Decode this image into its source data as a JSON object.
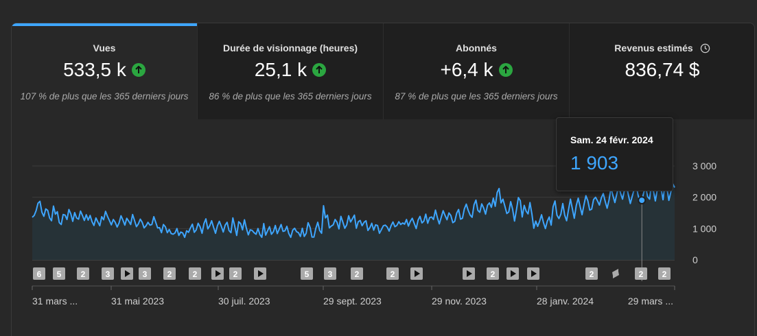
{
  "metrics": [
    {
      "label": "Vues",
      "value": "533,5 k",
      "trend": "up",
      "sub": "107 % de plus que les 365 derniers jours",
      "active": true
    },
    {
      "label": "Durée de visionnage (heures)",
      "value": "25,1 k",
      "trend": "up",
      "sub": "86 % de plus que les 365 derniers jours",
      "active": false
    },
    {
      "label": "Abonnés",
      "value": "+6,4 k",
      "trend": "up",
      "sub": "87 % de plus que les 365 derniers jours",
      "active": false
    },
    {
      "label": "Revenus estimés",
      "value": "836,74 $",
      "trend": "none",
      "sub": "",
      "active": false,
      "icon": "clock-icon"
    }
  ],
  "tooltip": {
    "date": "Sam. 24 févr. 2024",
    "value": "1 903"
  },
  "colors": {
    "line": "#3ea6ff",
    "accent": "#3ea6ff",
    "up": "#2ba640"
  },
  "chart_data": {
    "type": "line",
    "x_start": "2022-03-31",
    "x_end": "2024-03-29",
    "ylim": [
      0,
      3000
    ],
    "y_ticks": [
      "3 000",
      "2 000",
      "1 000",
      "0"
    ],
    "x_ticks": [
      "31 mars ...",
      "31 mai 2023",
      "30 juil. 2023",
      "29 sept. 2023",
      "29 nov. 2023",
      "28 janv. 2024",
      "29 mars ..."
    ],
    "highlight": {
      "date": "Sam. 24 févr. 2024",
      "value": 1903
    },
    "values": [
      1360,
      1420,
      1570,
      1810,
      1870,
      1520,
      1390,
      1630,
      1580,
      1340,
      1250,
      1720,
      1460,
      1540,
      1190,
      1130,
      1450,
      1430,
      1290,
      1610,
      1470,
      1230,
      1510,
      1340,
      1300,
      1560,
      1420,
      1260,
      1440,
      1270,
      1420,
      1220,
      1100,
      1340,
      1210,
      1090,
      1380,
      1280,
      1550,
      1390,
      1260,
      1120,
      1290,
      1200,
      1050,
      1180,
      1410,
      1270,
      1110,
      1330,
      1240,
      1130,
      1450,
      1260,
      1060,
      1150,
      1300,
      1200,
      1020,
      1090,
      1200,
      1110,
      1130,
      1380,
      1200,
      1020,
      1030,
      870,
      1130,
      1060,
      870,
      970,
      840,
      820,
      860,
      1000,
      780,
      890,
      860,
      720,
      930,
      880,
      1020,
      1140,
      880,
      960,
      1170,
      1060,
      850,
      1160,
      1310,
      990,
      1090,
      1250,
      1040,
      850,
      1090,
      1230,
      1070,
      890,
      1110,
      1200,
      940,
      870,
      1340,
      1070,
      780,
      1220,
      1160,
      960,
      1280,
      1010,
      800,
      960,
      940,
      870,
      820,
      1000,
      810,
      720,
      1160,
      790,
      930,
      1060,
      820,
      900,
      1100,
      840,
      980,
      1130,
      910,
      930,
      1070,
      840,
      720,
      950,
      1010,
      900,
      870,
      750,
      1010,
      750,
      850,
      1190,
      1040,
      730,
      730,
      1010,
      1200,
      940,
      850,
      1730,
      1340,
      1430,
      1020,
      1080,
      1120,
      1290,
      1200,
      990,
      1390,
      1210,
      1010,
      1120,
      1410,
      1210,
      1320,
      1430,
      1010,
      1220,
      1260,
      1090,
      1200,
      1250,
      940,
      1030,
      1170,
      950,
      1120,
      1100,
      850,
      970,
      1090,
      1110,
      1050,
      920,
      1090,
      1210,
      1060,
      1100,
      1220,
      1130,
      1180,
      1140,
      1290,
      1080,
      1230,
      1330,
      1170,
      1000,
      1270,
      1390,
      1180,
      1240,
      1460,
      1170,
      1350,
      1370,
      1290,
      1590,
      1350,
      1150,
      1360,
      1570,
      1420,
      1280,
      1500,
      1420,
      1190,
      1230,
      1490,
      1610,
      1300,
      1330,
      1630,
      1780,
      1580,
      1430,
      1360,
      1760,
      1910,
      1580,
      1520,
      1790,
      1660,
      1460,
      1750,
      1820,
      1680,
      1970,
      1710,
      2150,
      2280,
      1820,
      1940,
      1720,
      1480,
      1530,
      1860,
      1620,
      1240,
      1600,
      1990,
      1890,
      1370,
      1740,
      1560,
      1470,
      1830,
      1470,
      1010,
      1240,
      1070,
      1230,
      1440,
      1190,
      1000,
      1240,
      1370,
      1110,
      1700,
      1880,
      1430,
      1320,
      1460,
      1800,
      1430,
      1250,
      1610,
      1940,
      1630,
      1330,
      1730,
      1970,
      1700,
      1440,
      1760,
      2050,
      1890,
      1590,
      1620,
      1930,
      2000,
      1880,
      1750,
      1980,
      2120,
      1870,
      1650,
      1910,
      2300,
      2050,
      1830,
      2100,
      2370,
      2120,
      1940,
      2230,
      2380,
      2080,
      1800,
      2030,
      2250,
      2410,
      2080,
      1860,
      1903,
      2150,
      2330,
      2020,
      1940,
      2450,
      2200,
      1880,
      2240,
      2620,
      2260,
      1920,
      2410,
      2290,
      1900,
      2160,
      2430,
      2310
    ]
  },
  "markers": [
    {
      "kind": "num",
      "label": "6"
    },
    {
      "kind": "num",
      "label": "5"
    },
    {
      "kind": "num",
      "label": "2"
    },
    {
      "kind": "num",
      "label": "3"
    },
    {
      "kind": "play",
      "label": ""
    },
    {
      "kind": "num",
      "label": "3"
    },
    {
      "kind": "num",
      "label": "2"
    },
    {
      "kind": "num",
      "label": "2"
    },
    {
      "kind": "play",
      "label": ""
    },
    {
      "kind": "num",
      "label": "2"
    },
    {
      "kind": "play",
      "label": ""
    },
    {
      "kind": "num",
      "label": "5"
    },
    {
      "kind": "num",
      "label": "3"
    },
    {
      "kind": "num",
      "label": "2"
    },
    {
      "kind": "num",
      "label": "2"
    },
    {
      "kind": "play",
      "label": ""
    },
    {
      "kind": "play",
      "label": ""
    },
    {
      "kind": "num",
      "label": "2"
    },
    {
      "kind": "play",
      "label": ""
    },
    {
      "kind": "play",
      "label": ""
    },
    {
      "kind": "num",
      "label": "2"
    },
    {
      "kind": "shorts",
      "label": ""
    },
    {
      "kind": "num",
      "label": "2"
    },
    {
      "kind": "num",
      "label": "2"
    }
  ]
}
